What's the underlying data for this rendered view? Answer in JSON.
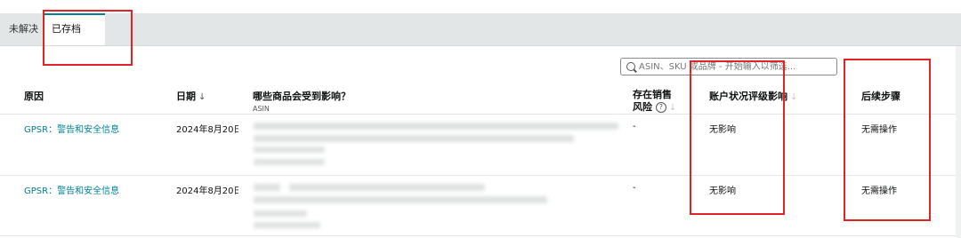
{
  "tabs": [
    {
      "label": "未解决"
    },
    {
      "label": "已存档",
      "icon": "question-circle-icon"
    }
  ],
  "search": {
    "placeholder": "ASIN、SKU 或品牌 - 开始输入以筛选..."
  },
  "columns": {
    "reason": "原因",
    "date": "日期",
    "affected": "哪些商品会受到影响？",
    "affected_sub": "ASIN",
    "risk_line1": "存在销售",
    "risk_line2": "风险",
    "impact": "账户状况评级影响",
    "next_steps": "后续步骤"
  },
  "rows": [
    {
      "reason": "GPSR：警告和安全信息",
      "date": "2024年8月20日",
      "risk": "-",
      "impact": "无影响",
      "next_steps": "无需操作"
    },
    {
      "reason": "GPSR：警告和安全信息",
      "date": "2024年8月20日",
      "risk": "-",
      "impact": "无影响",
      "next_steps": "无需操作"
    }
  ],
  "colors": {
    "link": "#008296",
    "highlight": "#e02424",
    "tab_accent": "#008296"
  }
}
